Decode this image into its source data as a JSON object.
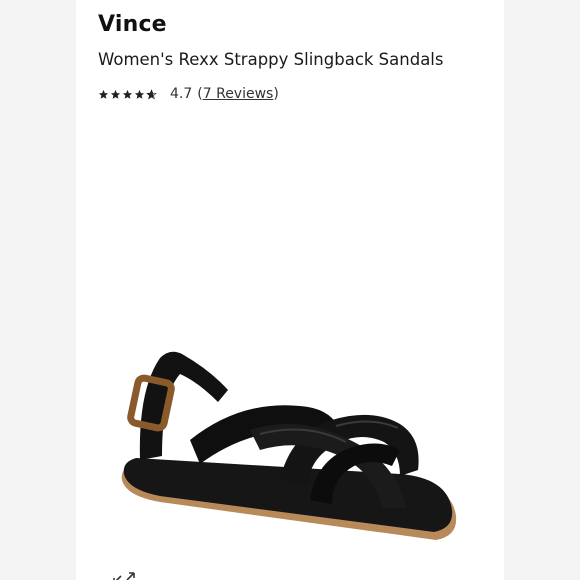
{
  "product": {
    "brand": "Vince",
    "title": "Women's Rexx Strappy Slingback Sandals",
    "rating": {
      "stars_filled": 4.7,
      "stars_max": 5,
      "value": "4.7",
      "reviews_label": "7 Reviews"
    },
    "image_icon": "sandal-image",
    "expand_icon": "expand-arrows-icon"
  },
  "colors": {
    "background": "#f4f4f4",
    "panel": "#ffffff",
    "text": "#1a1a1a",
    "sandal": "#111111",
    "buckle": "#8a5a2b"
  }
}
